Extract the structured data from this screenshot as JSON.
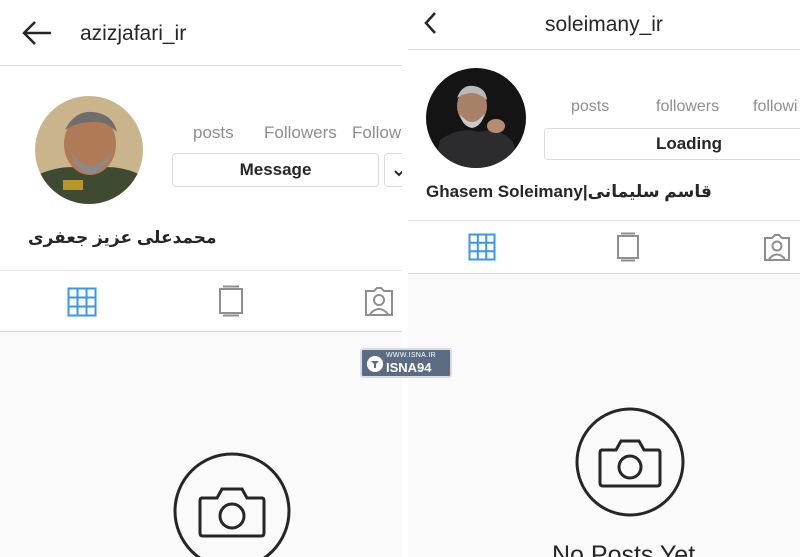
{
  "left_profile": {
    "username": "azizjafari_ir",
    "stats": {
      "posts_label": "posts",
      "followers_label": "Followers",
      "following_label": "Follow"
    },
    "message_button": "Message",
    "display_name": "محمدعلی عزیز جعفری",
    "empty_state": ""
  },
  "right_profile": {
    "username": "soleimany_ir",
    "stats": {
      "posts_label": "posts",
      "followers_label": "followers",
      "following_label": "followi"
    },
    "loading_button": "Loading",
    "display_name": "Ghasem Soleimany|قاسم سلیمانی",
    "empty_state": "No Posts Yet"
  },
  "watermark": {
    "url": "WWW.ISNA.IR",
    "brand": "ISNA94"
  },
  "colors": {
    "grid_tab_active": "#3897f0",
    "icon_inactive": "#8e8e8e",
    "border": "#dbdbdb"
  },
  "icons": [
    "back-arrow-icon",
    "chevron-left-icon",
    "grid-icon",
    "igtv-icon",
    "tagged-icon",
    "camera-icon",
    "dropdown-icon"
  ]
}
